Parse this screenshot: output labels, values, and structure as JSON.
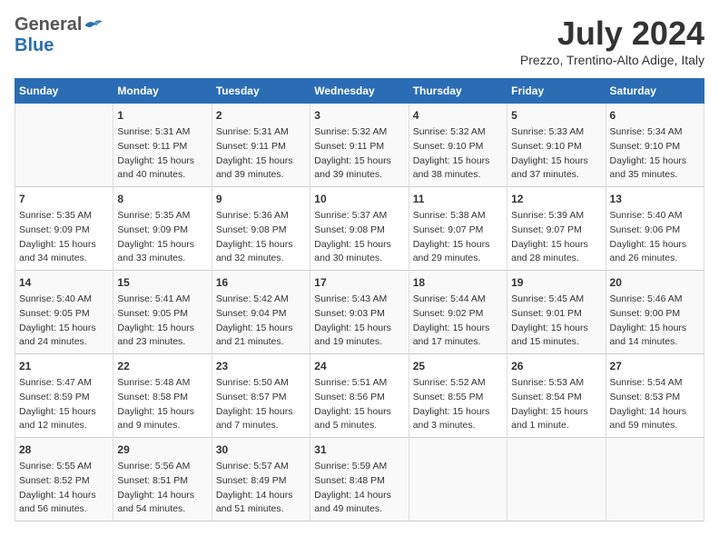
{
  "header": {
    "logo_general": "General",
    "logo_blue": "Blue",
    "title": "July 2024",
    "location": "Prezzo, Trentino-Alto Adige, Italy"
  },
  "calendar": {
    "days_of_week": [
      "Sunday",
      "Monday",
      "Tuesday",
      "Wednesday",
      "Thursday",
      "Friday",
      "Saturday"
    ],
    "weeks": [
      [
        {
          "num": "",
          "lines": []
        },
        {
          "num": "1",
          "lines": [
            "Sunrise: 5:31 AM",
            "Sunset: 9:11 PM",
            "Daylight: 15 hours",
            "and 40 minutes."
          ]
        },
        {
          "num": "2",
          "lines": [
            "Sunrise: 5:31 AM",
            "Sunset: 9:11 PM",
            "Daylight: 15 hours",
            "and 39 minutes."
          ]
        },
        {
          "num": "3",
          "lines": [
            "Sunrise: 5:32 AM",
            "Sunset: 9:11 PM",
            "Daylight: 15 hours",
            "and 39 minutes."
          ]
        },
        {
          "num": "4",
          "lines": [
            "Sunrise: 5:32 AM",
            "Sunset: 9:10 PM",
            "Daylight: 15 hours",
            "and 38 minutes."
          ]
        },
        {
          "num": "5",
          "lines": [
            "Sunrise: 5:33 AM",
            "Sunset: 9:10 PM",
            "Daylight: 15 hours",
            "and 37 minutes."
          ]
        },
        {
          "num": "6",
          "lines": [
            "Sunrise: 5:34 AM",
            "Sunset: 9:10 PM",
            "Daylight: 15 hours",
            "and 35 minutes."
          ]
        }
      ],
      [
        {
          "num": "7",
          "lines": [
            "Sunrise: 5:35 AM",
            "Sunset: 9:09 PM",
            "Daylight: 15 hours",
            "and 34 minutes."
          ]
        },
        {
          "num": "8",
          "lines": [
            "Sunrise: 5:35 AM",
            "Sunset: 9:09 PM",
            "Daylight: 15 hours",
            "and 33 minutes."
          ]
        },
        {
          "num": "9",
          "lines": [
            "Sunrise: 5:36 AM",
            "Sunset: 9:08 PM",
            "Daylight: 15 hours",
            "and 32 minutes."
          ]
        },
        {
          "num": "10",
          "lines": [
            "Sunrise: 5:37 AM",
            "Sunset: 9:08 PM",
            "Daylight: 15 hours",
            "and 30 minutes."
          ]
        },
        {
          "num": "11",
          "lines": [
            "Sunrise: 5:38 AM",
            "Sunset: 9:07 PM",
            "Daylight: 15 hours",
            "and 29 minutes."
          ]
        },
        {
          "num": "12",
          "lines": [
            "Sunrise: 5:39 AM",
            "Sunset: 9:07 PM",
            "Daylight: 15 hours",
            "and 28 minutes."
          ]
        },
        {
          "num": "13",
          "lines": [
            "Sunrise: 5:40 AM",
            "Sunset: 9:06 PM",
            "Daylight: 15 hours",
            "and 26 minutes."
          ]
        }
      ],
      [
        {
          "num": "14",
          "lines": [
            "Sunrise: 5:40 AM",
            "Sunset: 9:05 PM",
            "Daylight: 15 hours",
            "and 24 minutes."
          ]
        },
        {
          "num": "15",
          "lines": [
            "Sunrise: 5:41 AM",
            "Sunset: 9:05 PM",
            "Daylight: 15 hours",
            "and 23 minutes."
          ]
        },
        {
          "num": "16",
          "lines": [
            "Sunrise: 5:42 AM",
            "Sunset: 9:04 PM",
            "Daylight: 15 hours",
            "and 21 minutes."
          ]
        },
        {
          "num": "17",
          "lines": [
            "Sunrise: 5:43 AM",
            "Sunset: 9:03 PM",
            "Daylight: 15 hours",
            "and 19 minutes."
          ]
        },
        {
          "num": "18",
          "lines": [
            "Sunrise: 5:44 AM",
            "Sunset: 9:02 PM",
            "Daylight: 15 hours",
            "and 17 minutes."
          ]
        },
        {
          "num": "19",
          "lines": [
            "Sunrise: 5:45 AM",
            "Sunset: 9:01 PM",
            "Daylight: 15 hours",
            "and 15 minutes."
          ]
        },
        {
          "num": "20",
          "lines": [
            "Sunrise: 5:46 AM",
            "Sunset: 9:00 PM",
            "Daylight: 15 hours",
            "and 14 minutes."
          ]
        }
      ],
      [
        {
          "num": "21",
          "lines": [
            "Sunrise: 5:47 AM",
            "Sunset: 8:59 PM",
            "Daylight: 15 hours",
            "and 12 minutes."
          ]
        },
        {
          "num": "22",
          "lines": [
            "Sunrise: 5:48 AM",
            "Sunset: 8:58 PM",
            "Daylight: 15 hours",
            "and 9 minutes."
          ]
        },
        {
          "num": "23",
          "lines": [
            "Sunrise: 5:50 AM",
            "Sunset: 8:57 PM",
            "Daylight: 15 hours",
            "and 7 minutes."
          ]
        },
        {
          "num": "24",
          "lines": [
            "Sunrise: 5:51 AM",
            "Sunset: 8:56 PM",
            "Daylight: 15 hours",
            "and 5 minutes."
          ]
        },
        {
          "num": "25",
          "lines": [
            "Sunrise: 5:52 AM",
            "Sunset: 8:55 PM",
            "Daylight: 15 hours",
            "and 3 minutes."
          ]
        },
        {
          "num": "26",
          "lines": [
            "Sunrise: 5:53 AM",
            "Sunset: 8:54 PM",
            "Daylight: 15 hours",
            "and 1 minute."
          ]
        },
        {
          "num": "27",
          "lines": [
            "Sunrise: 5:54 AM",
            "Sunset: 8:53 PM",
            "Daylight: 14 hours",
            "and 59 minutes."
          ]
        }
      ],
      [
        {
          "num": "28",
          "lines": [
            "Sunrise: 5:55 AM",
            "Sunset: 8:52 PM",
            "Daylight: 14 hours",
            "and 56 minutes."
          ]
        },
        {
          "num": "29",
          "lines": [
            "Sunrise: 5:56 AM",
            "Sunset: 8:51 PM",
            "Daylight: 14 hours",
            "and 54 minutes."
          ]
        },
        {
          "num": "30",
          "lines": [
            "Sunrise: 5:57 AM",
            "Sunset: 8:49 PM",
            "Daylight: 14 hours",
            "and 51 minutes."
          ]
        },
        {
          "num": "31",
          "lines": [
            "Sunrise: 5:59 AM",
            "Sunset: 8:48 PM",
            "Daylight: 14 hours",
            "and 49 minutes."
          ]
        },
        {
          "num": "",
          "lines": []
        },
        {
          "num": "",
          "lines": []
        },
        {
          "num": "",
          "lines": []
        }
      ]
    ]
  }
}
